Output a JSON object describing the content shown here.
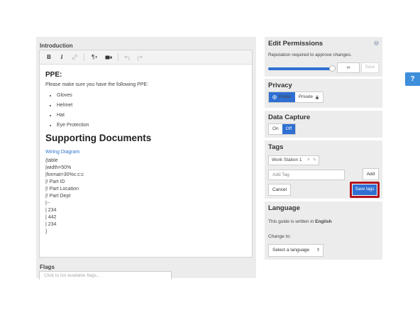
{
  "introduction": {
    "label": "Introduction",
    "toolbar": {
      "bold_label": "B",
      "italic_label": "I",
      "paragraph_label": "¶",
      "caret": "▾"
    },
    "content": {
      "ppe_heading": "PPE:",
      "ppe_intro": "Please make sure you have the following PPE:",
      "ppe_items": [
        "Gloves",
        "Helmet",
        "Hat",
        "Eye Protection"
      ],
      "docs_heading": "Supporting Documents",
      "doc_link": "Wiring Diagram",
      "table_lines": [
        "{table",
        "|width=50%",
        "|format=30%c:c:c",
        "|! Part ID",
        "|! Part Location",
        "|! Part Dept",
        "|--",
        "| 234",
        "| 442",
        "| 234",
        "}"
      ]
    }
  },
  "flags": {
    "label": "Flags",
    "placeholder": "Click to list available flags..."
  },
  "edit_permissions": {
    "title": "Edit Permissions",
    "description": "Reputation required to approve changes.",
    "value": "∞",
    "save_label": "Save",
    "slider_level": 1.0,
    "help_glyph": "?"
  },
  "privacy": {
    "title": "Privacy",
    "public_label": "Public",
    "private_label": "Private",
    "selected": "Public"
  },
  "data_capture": {
    "title": "Data Capture",
    "on_label": "On",
    "off_label": "Off",
    "selected": "Off"
  },
  "tags": {
    "title": "Tags",
    "chips": [
      "Work Station 1"
    ],
    "add_placeholder": "Add Tag",
    "add_label": "Add",
    "cancel_label": "Cancel",
    "save_label": "Save tags",
    "highlight_color": "#b1141a"
  },
  "language": {
    "title": "Language",
    "current_prefix": "This guide is written in",
    "current_value": "English",
    "change_to_label": "Change to:",
    "select_placeholder": "Select a language"
  },
  "help_tab": {
    "label": "?"
  },
  "colors": {
    "accent": "#2f6fd2",
    "panel": "#ececec",
    "link": "#2e73c9"
  }
}
